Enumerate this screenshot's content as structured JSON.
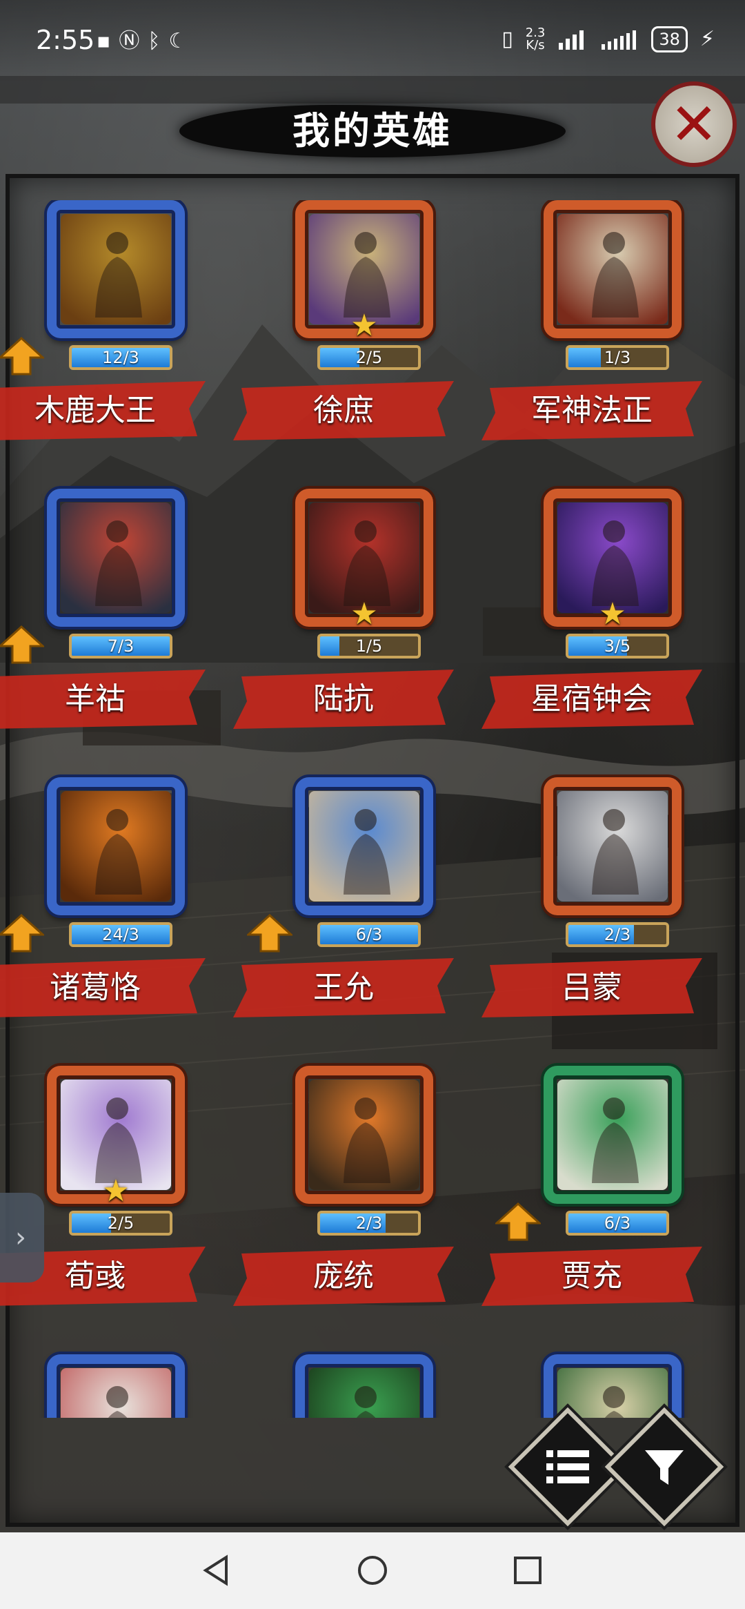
{
  "status_bar": {
    "time": "2:55",
    "speed_top": "2.3",
    "speed_bottom": "K/s",
    "battery": "38"
  },
  "title": "我的英雄",
  "close_label": "✕",
  "heroes": [
    {
      "name": "木鹿大王",
      "progress": "12/3",
      "fill": 1.0,
      "frame": "blue",
      "upgrade": true,
      "star": false,
      "tint": [
        "#b48a2a",
        "#6b3f12"
      ]
    },
    {
      "name": "徐庶",
      "progress": "2/5",
      "fill": 0.4,
      "frame": "orange",
      "upgrade": false,
      "star": true,
      "tint": [
        "#c9b27a",
        "#5a3a7a"
      ]
    },
    {
      "name": "军神法正",
      "progress": "1/3",
      "fill": 0.33,
      "frame": "orange",
      "upgrade": false,
      "star": false,
      "tint": [
        "#d7cbb0",
        "#7a2a1a"
      ]
    },
    {
      "name": "羊祜",
      "progress": "7/3",
      "fill": 1.0,
      "frame": "blue",
      "upgrade": true,
      "star": false,
      "tint": [
        "#c04535",
        "#2a3040"
      ]
    },
    {
      "name": "陆抗",
      "progress": "1/5",
      "fill": 0.2,
      "frame": "orange",
      "upgrade": false,
      "star": true,
      "tint": [
        "#b3322a",
        "#3a1a18"
      ]
    },
    {
      "name": "星宿钟会",
      "progress": "3/5",
      "fill": 0.6,
      "frame": "orange",
      "upgrade": false,
      "star": true,
      "tint": [
        "#8a4ac9",
        "#2a1a5a"
      ]
    },
    {
      "name": "诸葛恪",
      "progress": "24/3",
      "fill": 1.0,
      "frame": "blue",
      "upgrade": true,
      "star": false,
      "tint": [
        "#e07a22",
        "#5a2a0a"
      ]
    },
    {
      "name": "王允",
      "progress": "6/3",
      "fill": 1.0,
      "frame": "blue",
      "upgrade": true,
      "star": false,
      "tint": [
        "#5a8ad0",
        "#c9b79a"
      ]
    },
    {
      "name": "吕蒙",
      "progress": "2/3",
      "fill": 0.67,
      "frame": "orange",
      "upgrade": false,
      "star": false,
      "tint": [
        "#d9d9d9",
        "#6a6e78"
      ]
    },
    {
      "name": "荀彧",
      "progress": "2/5",
      "fill": 0.4,
      "frame": "orange",
      "upgrade": false,
      "star": true,
      "tint": [
        "#a07ad0",
        "#e8e4f0"
      ]
    },
    {
      "name": "庞统",
      "progress": "2/3",
      "fill": 0.67,
      "frame": "orange",
      "upgrade": false,
      "star": false,
      "tint": [
        "#e0792a",
        "#3a2a1a"
      ]
    },
    {
      "name": "贾充",
      "progress": "6/3",
      "fill": 1.0,
      "frame": "green",
      "upgrade": true,
      "star": false,
      "tint": [
        "#3aa05a",
        "#d8dccc"
      ]
    },
    {
      "name": "",
      "progress": "",
      "fill": 0,
      "frame": "blue",
      "upgrade": false,
      "star": false,
      "tint": [
        "#e8e2dc",
        "#c06060"
      ]
    },
    {
      "name": "",
      "progress": "",
      "fill": 0,
      "frame": "blue",
      "upgrade": false,
      "star": false,
      "tint": [
        "#3aa050",
        "#1a3a1a"
      ]
    },
    {
      "name": "",
      "progress": "",
      "fill": 0,
      "frame": "blue",
      "upgrade": false,
      "star": false,
      "tint": [
        "#d8d0a8",
        "#3a6a3a"
      ]
    }
  ],
  "icons": {
    "list": "list-icon",
    "filter": "filter-icon",
    "side_tab": "chevron-right-icon"
  },
  "colors": {
    "banner_red": "#c8271c",
    "arrow_orange": "#f2a320",
    "progress_blue": "#2a8fe6"
  }
}
